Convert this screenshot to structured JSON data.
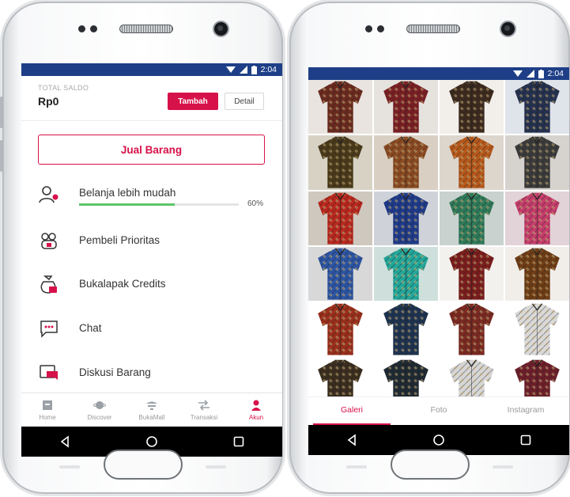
{
  "status": {
    "time": "2:04"
  },
  "account": {
    "saldo_label": "TOTAL SALDO",
    "saldo_value": "Rp0",
    "tambah_label": "Tambah",
    "detail_label": "Detail",
    "jual_label": "Jual Barang"
  },
  "menu": {
    "belanja": {
      "label": "Belanja lebih mudah",
      "progress": 60,
      "progress_text": "60%"
    },
    "pembeli": {
      "label": "Pembeli Prioritas"
    },
    "credits": {
      "label": "Bukalapak Credits"
    },
    "chat": {
      "label": "Chat"
    },
    "diskusi": {
      "label": "Diskusi Barang"
    }
  },
  "bottom_tabs": {
    "home": "Home",
    "discover": "Discover",
    "bukamall": "BukaMall",
    "transaksi": "Transaksi",
    "akun": "Akun"
  },
  "gallery_tabs": {
    "galeri": "Galeri",
    "foto": "Foto",
    "instagram": "Instagram"
  },
  "colors": {
    "accent": "#d71149",
    "statusbar": "#1e3f87",
    "progress": "#5cc56a"
  },
  "gallery": {
    "items": [
      {
        "bg": "#e9e4df",
        "shirt": "#6b2a1f"
      },
      {
        "bg": "#e6e2de",
        "shirt": "#7a1f24"
      },
      {
        "bg": "#f2efeb",
        "shirt": "#3c2a1e"
      },
      {
        "bg": "#dfe3ea",
        "shirt": "#24314f"
      },
      {
        "bg": "#d7d2c4",
        "shirt": "#4a3a1a"
      },
      {
        "bg": "#d9cfc3",
        "shirt": "#8a4a22"
      },
      {
        "bg": "#dcd6cd",
        "shirt": "#b5581c"
      },
      {
        "bg": "#d6d3cf",
        "shirt": "#3b3b3b"
      },
      {
        "bg": "#cfc8bf",
        "shirt": "#b8281f"
      },
      {
        "bg": "#cfd3d9",
        "shirt": "#1f3b8a"
      },
      {
        "bg": "#c9d2cf",
        "shirt": "#2f7a5a"
      },
      {
        "bg": "#e2d3d8",
        "shirt": "#c43d6b"
      },
      {
        "bg": "#d8d8d8",
        "shirt": "#2d55a3"
      },
      {
        "bg": "#cfe0dc",
        "shirt": "#23a69a"
      },
      {
        "bg": "#f3f1ee",
        "shirt": "#7a1d1d"
      },
      {
        "bg": "#f1eeea",
        "shirt": "#6e3d16"
      },
      {
        "bg": "#ffffff",
        "shirt": "#9a2f1c"
      },
      {
        "bg": "#ffffff",
        "shirt": "#1e3350"
      },
      {
        "bg": "#ffffff",
        "shirt": "#7b2a22"
      },
      {
        "bg": "#ffffff",
        "shirt": "#d9d9d9"
      },
      {
        "bg": "#ffffff",
        "shirt": "#3b2e1f"
      },
      {
        "bg": "#ffffff",
        "shirt": "#1f2a33"
      },
      {
        "bg": "#ffffff",
        "shirt": "#d6d6d6"
      },
      {
        "bg": "#ffffff",
        "shirt": "#6d1f2a"
      }
    ]
  }
}
